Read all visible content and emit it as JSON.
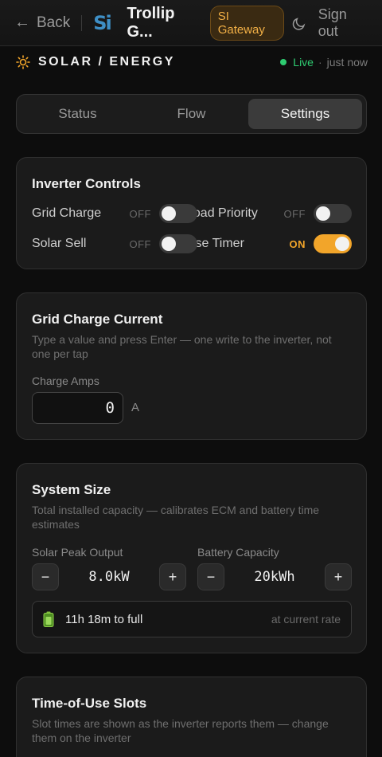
{
  "header": {
    "back_label": "Back",
    "app_title": "Trollip G...",
    "logo_text": "Si",
    "gateway_badge": "SI Gateway",
    "signout_label": "Sign out"
  },
  "section": {
    "title": "SOLAR / ENERGY",
    "live_label": "Live",
    "updated": "just now"
  },
  "tabs": [
    {
      "label": "Status",
      "active": false
    },
    {
      "label": "Flow",
      "active": false
    },
    {
      "label": "Settings",
      "active": true
    }
  ],
  "inverter_controls": {
    "title": "Inverter Controls",
    "items": [
      {
        "label": "Grid Charge",
        "state": "OFF",
        "on": false
      },
      {
        "label": "Load Priority",
        "state": "OFF",
        "on": false
      },
      {
        "label": "Solar Sell",
        "state": "OFF",
        "on": false
      },
      {
        "label": "Use Timer",
        "state": "ON",
        "on": true
      }
    ]
  },
  "grid_charge_current": {
    "title": "Grid Charge Current",
    "description": "Type a value and press Enter — one write to the inverter, not one per tap",
    "field_label": "Charge Amps",
    "value": "0",
    "unit": "A"
  },
  "system_size": {
    "title": "System Size",
    "description": "Total installed capacity — calibrates ECM and battery time estimates",
    "solar": {
      "label": "Solar Peak Output",
      "value": "8.0kW"
    },
    "battery": {
      "label": "Battery Capacity",
      "value": "20kWh"
    },
    "minus": "−",
    "plus": "+",
    "estimate": {
      "main": "11h 18m to full",
      "side": "at current rate"
    }
  },
  "tou": {
    "title": "Time-of-Use Slots",
    "description": "Slot times are shown as the inverter reports them — change them on the inverter"
  },
  "colors": {
    "accent": "#f2a52a",
    "live": "#2ecc71",
    "logo": "#3e8fc6"
  }
}
